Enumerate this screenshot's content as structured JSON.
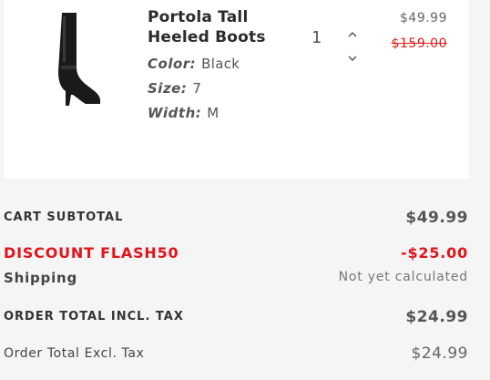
{
  "item": {
    "name": "Portola Tall Heeled Boots",
    "color_label": "Color:",
    "color_value": "Black",
    "size_label": "Size:",
    "size_value": "7",
    "width_label": "Width:",
    "width_value": "M",
    "quantity": "1",
    "price": "$49.99",
    "original_price": "$159.00",
    "image_icon": "tall-boot-image"
  },
  "summary": {
    "subtotal_label": "CART SUBTOTAL",
    "subtotal_value": "$49.99",
    "discount_label": "DISCOUNT FLASH50",
    "discount_value": "-$25.00",
    "shipping_label": "Shipping",
    "shipping_value": "Not yet calculated",
    "total_incl_label": "ORDER TOTAL INCL. TAX",
    "total_incl_value": "$24.99",
    "total_excl_label": "Order Total Excl. Tax",
    "total_excl_value": "$24.99"
  },
  "colors": {
    "discount": "#e0141b",
    "strikethrough_price": "#e0211d",
    "card_background": "#ffffff",
    "page_background": "#f5f5f5"
  }
}
